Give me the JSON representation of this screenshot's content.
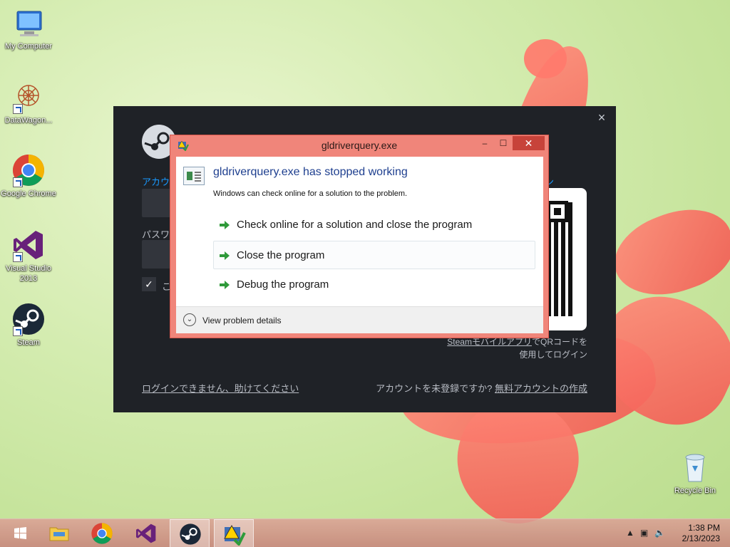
{
  "desktop": {
    "icons": [
      {
        "label": "My Computer",
        "icon": "computer-icon"
      },
      {
        "label": "DataWagon...",
        "icon": "datawagon-icon"
      },
      {
        "label": "Google Chrome",
        "icon": "chrome-icon"
      },
      {
        "label": "Visual Studio 2013",
        "icon": "visual-studio-icon"
      },
      {
        "label": "Steam",
        "icon": "steam-icon"
      },
      {
        "label": "Recycle Bin",
        "icon": "recycle-bin-icon"
      }
    ]
  },
  "steam_window": {
    "account_label": "アカウ",
    "password_label": "パスワ",
    "remember_label": "こ",
    "side_label": "ン",
    "mobile_link": "Steamモバイルアプリ",
    "mobile_rest": "でQRコードを",
    "mobile_line2": "使用してログイン",
    "help_link": "ログインできません、助けてください",
    "signup_prompt": "アカウントを未登録ですか?",
    "signup_link": "無料アカウントの作成",
    "close_glyph": "×"
  },
  "dialog": {
    "title": "gldriverquery.exe",
    "heading": "gldriverquery.exe has stopped working",
    "subtext": "Windows can check online for a solution to the problem.",
    "options": [
      "Check online for a solution and close the program",
      "Close the program",
      "Debug the program"
    ],
    "details_label": "View problem details",
    "min_glyph": "–",
    "max_glyph": "☐",
    "close_glyph": "✕"
  },
  "taskbar": {
    "time": "1:38 PM",
    "date": "2/13/2023",
    "items": [
      "start-button",
      "file-explorer",
      "chrome",
      "visual-studio",
      "steam",
      "gldriverquery"
    ]
  },
  "colors": {
    "dialog_frame": "#f0857a",
    "dialog_heading": "#1e3f8f",
    "steam_bg": "#1f2227",
    "steam_accent": "#1999ff"
  }
}
